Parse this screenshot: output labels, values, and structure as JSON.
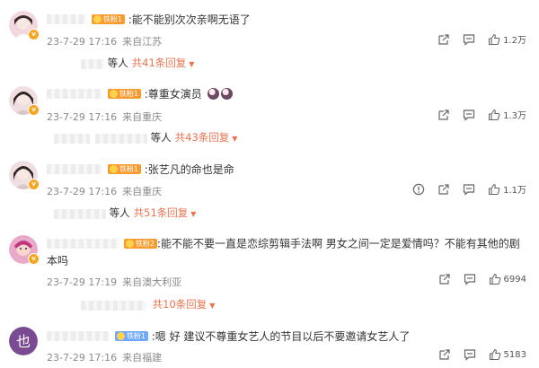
{
  "comments": [
    {
      "text": ":能不能别次次亲啊无语了",
      "badge": "铁粉1",
      "timestamp": "23-7-29 17:16",
      "location": "来自江苏",
      "likes": "1.2万",
      "replies_prefix": "等人",
      "replies_count": "共41条回复",
      "avatar_color": "#f2d7de"
    },
    {
      "text": ":尊重女演员",
      "badge": "铁粉1",
      "timestamp": "23-7-29 17:16",
      "location": "来自重庆",
      "likes": "1.3万",
      "replies_prefix": "等人",
      "replies_count": "共43条回复",
      "avatar_color": "#f0dfe0"
    },
    {
      "text": ":张艺凡的命也是命",
      "badge": "铁粉1",
      "timestamp": "23-7-29 17:16",
      "location": "来自重庆",
      "likes": "1.1万",
      "replies_prefix": "等人",
      "replies_count": "共51条回复",
      "avatar_color": "#f0dfe0"
    },
    {
      "text": ":能不能不要一直是恋综剪辑手法啊 男女之间一定是爱情吗？不能有其他的剧本吗",
      "badge": "铁粉2",
      "timestamp": "23-7-29 17:19",
      "location": "来自澳大利亚",
      "likes": "6994",
      "replies_prefix": "",
      "replies_count": "共10条回复",
      "avatar_color": "#e9a9c9"
    },
    {
      "text": ":嗯 好 建议不尊重女艺人的节目以后不要邀请女艺人了",
      "badge": "铁粉1",
      "timestamp": "23-7-29 17:16",
      "location": "来自福建",
      "likes": "5183",
      "avatar_color": "#7a4a93",
      "avatar_text": "也"
    }
  ],
  "colors": {
    "accent": "#eb7350",
    "meta": "#8a8a8a",
    "badge_fan": "#f89a2d",
    "badge_blue": "#6fa8ff"
  },
  "icons": [
    "share-icon",
    "comment-icon",
    "like-icon",
    "report-icon",
    "chevron-down-icon",
    "verified-icon"
  ]
}
